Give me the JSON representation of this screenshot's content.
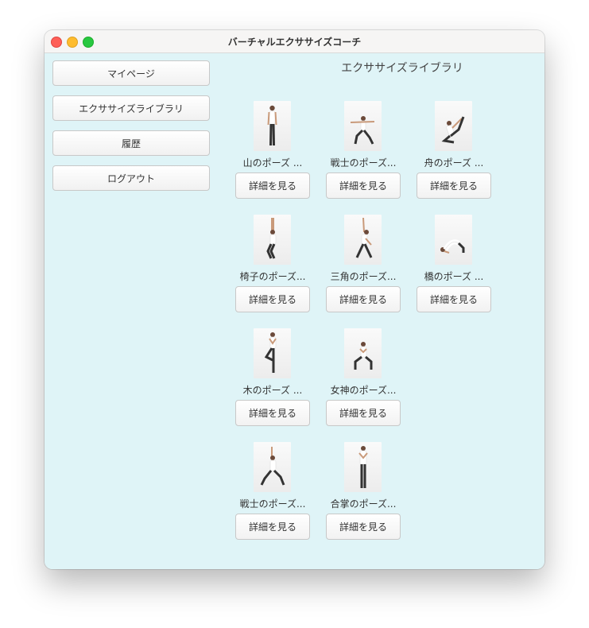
{
  "window": {
    "title": "バーチャルエクササイズコーチ"
  },
  "sidebar": {
    "items": [
      {
        "label": "マイページ"
      },
      {
        "label": "エクササイズライブラリ"
      },
      {
        "label": "履歴"
      },
      {
        "label": "ログアウト"
      }
    ]
  },
  "library": {
    "title": "エクササイズライブラリ",
    "detail_label": "詳細を見る",
    "poses": [
      {
        "label": "山のポーズ ..."
      },
      {
        "label": "戦士のポーズ..."
      },
      {
        "label": "舟のポーズ ..."
      },
      {
        "label": "椅子のポーズ..."
      },
      {
        "label": "三角のポーズ..."
      },
      {
        "label": "橋のポーズ ..."
      },
      {
        "label": "木のポーズ ..."
      },
      {
        "label": "女神のポーズ..."
      },
      {
        "label": "戦士のポーズ..."
      },
      {
        "label": "合掌のポーズ..."
      }
    ]
  }
}
